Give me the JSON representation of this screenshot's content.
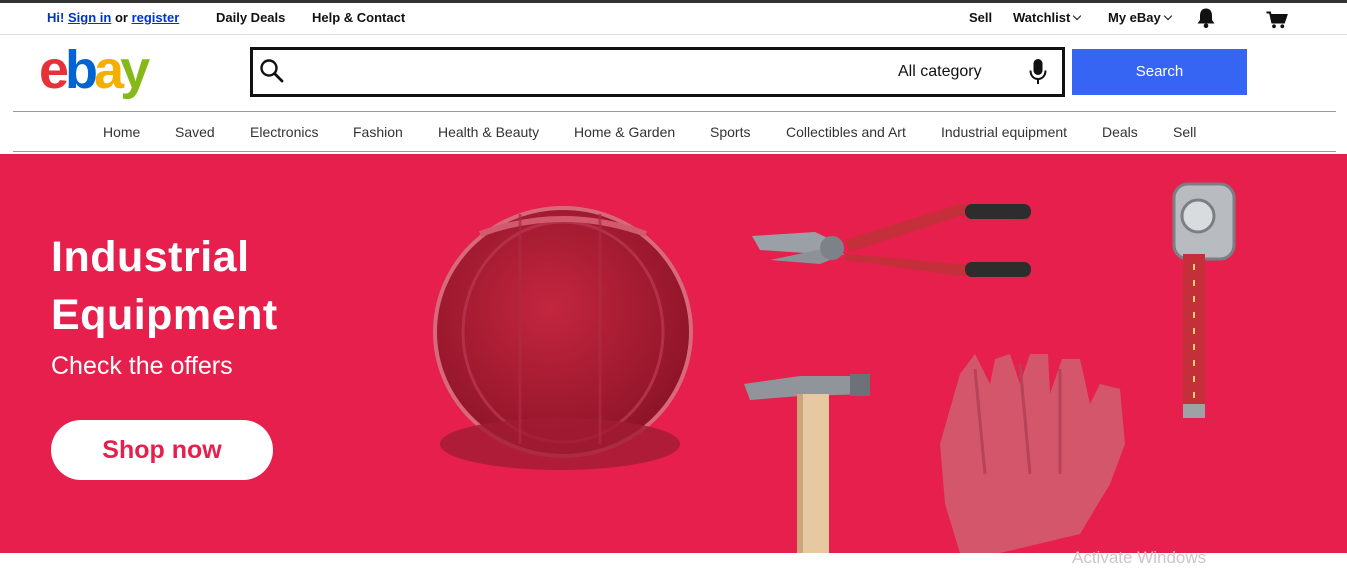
{
  "topbar": {
    "greeting": "Hi!",
    "sign_in": "Sign in",
    "or": "or",
    "register": "register",
    "daily_deals": "Daily Deals",
    "help_contact": "Help & Contact",
    "sell": "Sell",
    "watchlist": "Watchlist",
    "my_ebay": "My eBay",
    "icons": [
      "bell-icon",
      "cart-icon"
    ]
  },
  "logo": {
    "letters": [
      "e",
      "b",
      "a",
      "y"
    ]
  },
  "search": {
    "value": "",
    "placeholder": "",
    "category": "All category",
    "button": "Search",
    "icons": [
      "search-icon",
      "microphone-icon"
    ]
  },
  "nav": {
    "items": [
      "Home",
      "Saved",
      "Electronics",
      "Fashion",
      "Health & Beauty",
      "Home & Garden",
      "Sports",
      "Collectibles and Art",
      "Industrial equipment",
      "Deals",
      "Sell"
    ]
  },
  "hero": {
    "title_line1": "Industrial",
    "title_line2": "Equipment",
    "subtitle": "Check the offers",
    "cta": "Shop now",
    "background": "#e61f4c"
  },
  "watermark": "Activate Windows",
  "colors": {
    "accent_blue": "#3665f3",
    "logo_red": "#e53238",
    "logo_blue": "#0064d2",
    "logo_yellow": "#f5af02",
    "logo_green": "#86b817"
  }
}
